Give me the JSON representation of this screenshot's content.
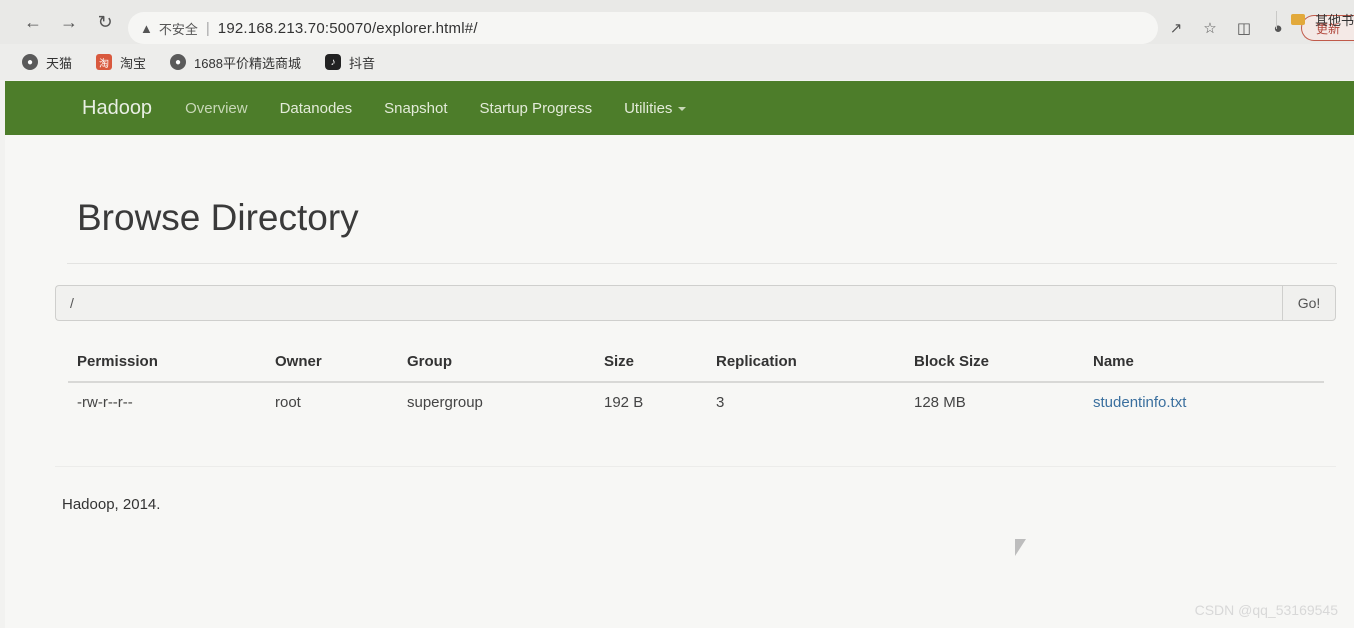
{
  "browser": {
    "address": {
      "warning": "不安全",
      "url": "192.168.213.70:50070/explorer.html#/"
    },
    "update_label": "更新",
    "bookmarks": [
      {
        "label": "天猫",
        "icon": "globe-icon"
      },
      {
        "label": "淘宝",
        "icon": "taobao-icon"
      },
      {
        "label": "1688平价精选商城",
        "icon": "globe-icon"
      },
      {
        "label": "抖音",
        "icon": "tiktok-icon"
      }
    ],
    "other_bookmarks": "其他书"
  },
  "navbar": {
    "brand": "Hadoop",
    "items": [
      "Overview",
      "Datanodes",
      "Snapshot",
      "Startup Progress",
      "Utilities"
    ]
  },
  "page": {
    "title": "Browse Directory",
    "path_value": "/",
    "go_label": "Go!"
  },
  "table": {
    "headers": [
      "Permission",
      "Owner",
      "Group",
      "Size",
      "Replication",
      "Block Size",
      "Name"
    ],
    "rows": [
      {
        "permission": "-rw-r--r--",
        "owner": "root",
        "group": "supergroup",
        "size": "192 B",
        "replication": "3",
        "block_size": "128 MB",
        "name": "studentinfo.txt"
      }
    ]
  },
  "footer": "Hadoop, 2014.",
  "watermark": "CSDN @qq_53169545"
}
